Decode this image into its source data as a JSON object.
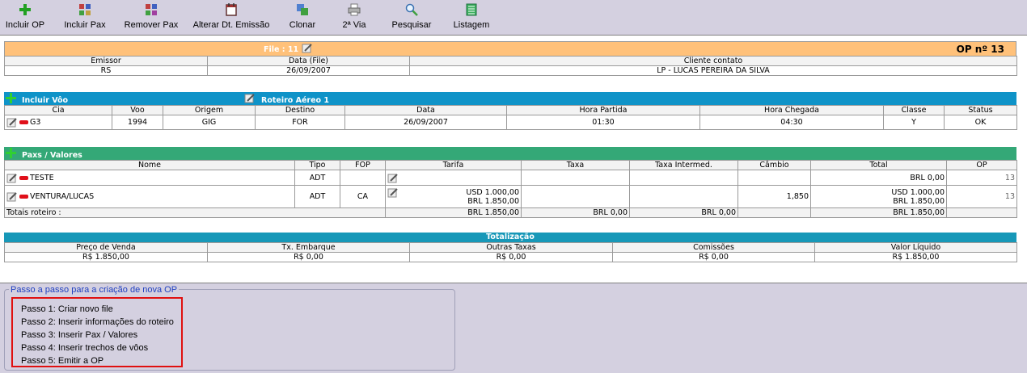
{
  "toolbar": {
    "items": [
      {
        "label": "Incluir OP",
        "icon": "green-plus-icon"
      },
      {
        "label": "Incluir Pax",
        "icon": "add-pax-icon"
      },
      {
        "label": "Remover Pax",
        "icon": "remove-pax-icon"
      },
      {
        "label": "Alterar Dt. Emissão",
        "icon": "calendar-icon"
      },
      {
        "label": "Clonar",
        "icon": "clone-icon"
      },
      {
        "label": "2ª Via",
        "icon": "printer-icon"
      },
      {
        "label": "Pesquisar",
        "icon": "search-icon"
      },
      {
        "label": "Listagem",
        "icon": "list-icon"
      }
    ]
  },
  "file": {
    "title": "File : 11",
    "op_label": "OP nº 13",
    "headers": [
      "Emissor",
      "Data (File)",
      "Cliente contato"
    ],
    "values": [
      "RS",
      "26/09/2007",
      "LP - LUCAS PEREIRA DA SILVA"
    ]
  },
  "flights": {
    "include_label": "Incluir Vôo",
    "roteiro_label": "Roteiro Aéreo 1",
    "headers": [
      "Cia",
      "Voo",
      "Origem",
      "Destino",
      "Data",
      "Hora Partida",
      "Hora Chegada",
      "Classe",
      "Status"
    ],
    "rows": [
      {
        "cia": "G3",
        "voo": "1994",
        "origem": "GIG",
        "destino": "FOR",
        "data": "26/09/2007",
        "partida": "01:30",
        "chegada": "04:30",
        "classe": "Y",
        "status": "OK"
      }
    ]
  },
  "paxs": {
    "title": "Paxs / Valores",
    "headers": [
      "Nome",
      "Tipo",
      "FOP",
      "Tarifa",
      "Taxa",
      "Taxa Intermed.",
      "Câmbio",
      "Total",
      "OP"
    ],
    "rows": [
      {
        "nome": "TESTE",
        "tipo": "ADT",
        "fop": "",
        "tarifa1": "",
        "tarifa2": "",
        "taxa": "",
        "intermed": "",
        "cambio": "",
        "total1": "BRL 0,00",
        "total2": "",
        "op": "13"
      },
      {
        "nome": "VENTURA/LUCAS",
        "tipo": "ADT",
        "fop": "CA",
        "tarifa1": "USD 1.000,00",
        "tarifa2": "BRL 1.850,00",
        "taxa": "",
        "intermed": "",
        "cambio": "1,850",
        "total1": "USD 1.000,00",
        "total2": "BRL 1.850,00",
        "op": "13"
      }
    ],
    "totals": {
      "label": "Totais roteiro :",
      "tarifa": "BRL 1.850,00",
      "taxa": "BRL 0,00",
      "intermed": "BRL 0,00",
      "total": "BRL 1.850,00"
    }
  },
  "totalizacao": {
    "title": "Totalização",
    "headers": [
      "Preço de Venda",
      "Tx. Embarque",
      "Outras Taxas",
      "Comissões",
      "Valor Líquido"
    ],
    "values": [
      "R$ 1.850,00",
      "R$ 0,00",
      "R$ 0,00",
      "R$ 0,00",
      "R$ 1.850,00"
    ]
  },
  "steps": {
    "legend": "Passo a passo para a criação de nova OP",
    "items": [
      "Passo 1: Criar novo file",
      "Passo 2: Inserir informações do roteiro",
      "Passo 3: Inserir Pax / Valores",
      "Passo 4: Inserir trechos de vôos",
      "Passo 5: Emitir a OP"
    ]
  },
  "colors": {
    "orange_bar": "#ffc17a",
    "blue_bar": "#0f93c8",
    "green_bar": "#34a877",
    "teal_bar": "#1798b8",
    "steps_border": "#e01010"
  }
}
